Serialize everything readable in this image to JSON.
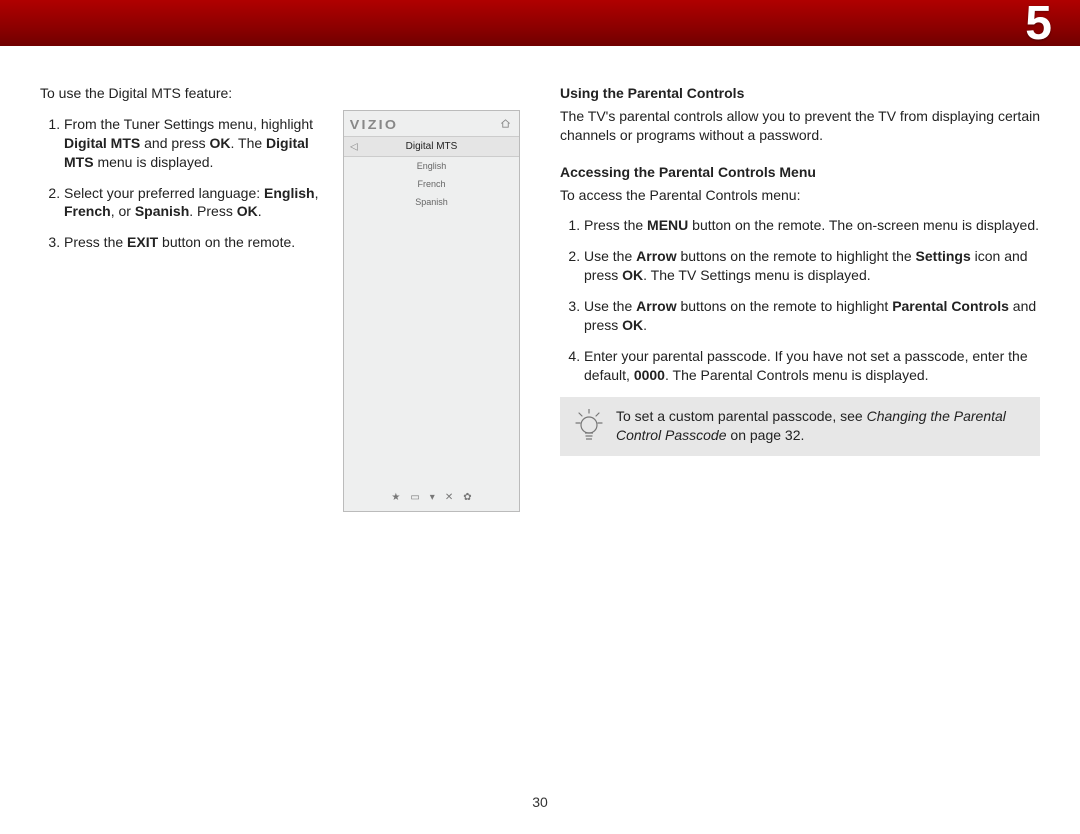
{
  "chapter": "5",
  "page_number": "30",
  "left": {
    "intro": "To use the Digital MTS feature:",
    "steps": [
      {
        "pre": "From the Tuner Settings menu, highlight ",
        "b1": "Digital MTS",
        "mid1": " and press ",
        "b2": "OK",
        "mid2": ". The ",
        "b3": "Digital MTS",
        "post": " menu is displayed."
      },
      {
        "pre": "Select your preferred language: ",
        "b1": "English",
        "sep1": ", ",
        "b2": "French",
        "sep2": ", or ",
        "b3": "Spanish",
        "mid": ". Press ",
        "b4": "OK",
        "post": "."
      },
      {
        "pre": "Press the ",
        "b1": "EXIT",
        "post": " button on the remote."
      }
    ]
  },
  "tv_menu": {
    "logo": "VIZIO",
    "title": "Digital MTS",
    "items": [
      "English",
      "French",
      "Spanish"
    ],
    "bottom_glyphs": {
      "star": "★",
      "box": "▭",
      "caret": "▾",
      "x": "✕",
      "gear": "✿"
    }
  },
  "right": {
    "head1": "Using the Parental Controls",
    "paragraph1": "The TV's parental controls allow you to prevent the TV from displaying certain channels or programs without a password.",
    "head2": "Accessing the Parental Controls Menu",
    "intro2": "To access the Parental Controls menu:",
    "steps": [
      {
        "pre": "Press the ",
        "b1": "MENU",
        "post": " button on the remote. The on-screen menu is displayed."
      },
      {
        "pre": "Use the ",
        "b1": "Arrow",
        "mid1": " buttons on the remote to highlight the ",
        "b2": "Settings",
        "mid2": " icon and press ",
        "b3": "OK",
        "post": ". The TV Settings menu is displayed."
      },
      {
        "pre": "Use the ",
        "b1": "Arrow",
        "mid1": " buttons on the remote to highlight ",
        "b2": "Parental Controls",
        "mid2": " and press ",
        "b3": "OK",
        "post": "."
      },
      {
        "pre": "Enter your parental passcode. If you have not set a passcode, enter the default, ",
        "b1": "0000",
        "post": ". The Parental Controls menu is displayed."
      }
    ],
    "tip": {
      "text_pre": "To set a custom parental passcode, see ",
      "italic": "Changing the Parental Control Passcode",
      "text_post": " on page 32."
    }
  }
}
